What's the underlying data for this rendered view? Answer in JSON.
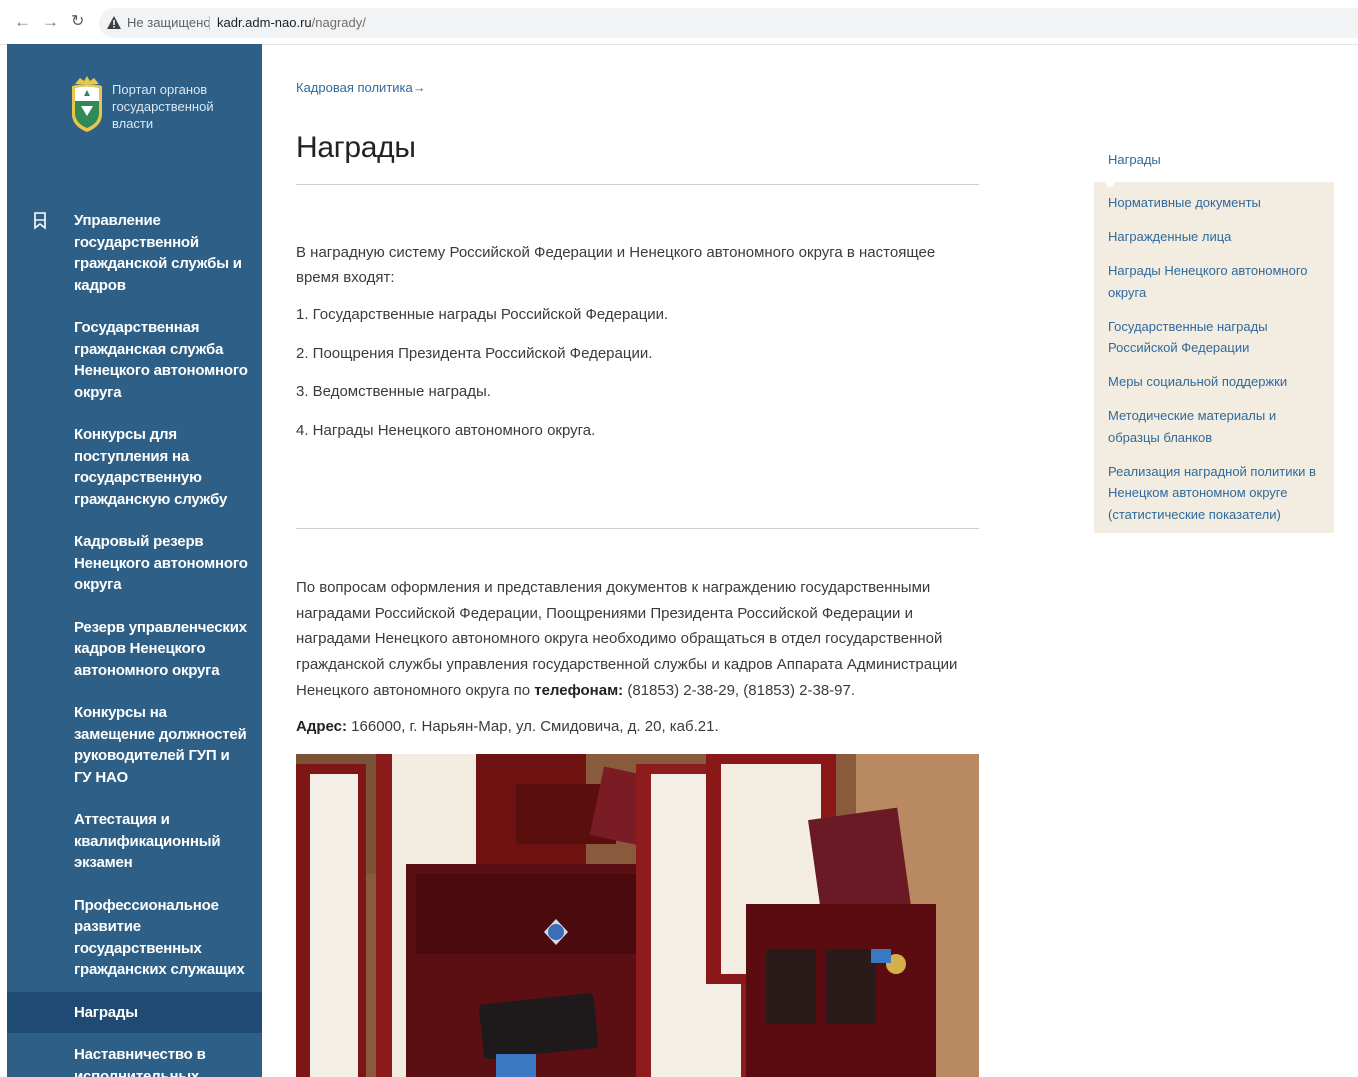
{
  "browser": {
    "security": "Не защищено",
    "url_host": "kadr.adm-nao.ru",
    "url_path": "/nagrady/"
  },
  "sidebar": {
    "portal_title": "Портал органов государственной власти",
    "items": [
      {
        "label": "Управление государственной гражданской службы и кадров",
        "icon": "bookmark-icon"
      },
      {
        "label": "Государственная гражданская служба Ненецкого автономного округа"
      },
      {
        "label": "Конкурсы для поступления на государственную гражданскую службу"
      },
      {
        "label": "Кадровый резерв Ненецкого автономного округа"
      },
      {
        "label": "Резерв управленческих кадров Ненецкого автономного округа"
      },
      {
        "label": "Конкурсы на замещение должностей руководителей ГУП и ГУ НАО"
      },
      {
        "label": "Аттестация и квалификационный экзамен"
      },
      {
        "label": "Профессиональное развитие государственных гражданских служащих"
      },
      {
        "label": "Награды",
        "active": true
      },
      {
        "label": "Наставничество в исполнительных"
      }
    ]
  },
  "main": {
    "breadcrumb": "Кадровая политика→",
    "title": "Награды",
    "intro": "В наградную систему Российской Федерации и Ненецкого автономного округа в настоящее время входят:",
    "list": [
      "1. Государственные награды Российской Федерации.",
      "2. Поощрения Президента Российской Федерации.",
      "3. Ведомственные награды.",
      "4. Награды Ненецкого автономного округа."
    ],
    "contact_text": "По вопросам оформления и представления документов к награждению государственными наградами Российской Федерации, Поощрениями Президента Российской Федерации и наградами Ненецкого автономного округа необходимо обращаться в отдел государственной гражданской службы управления государственной службы и кадров Аппарата Администрации Ненецкого автономного округа по",
    "phones_label": "телефонам:",
    "phones": "(81853) 2-38-29, (81853) 2-38-97.",
    "address_label": "Адрес:",
    "address": "166000, г. Нарьян-Мар, ул. Смидовича, д. 20, каб.21."
  },
  "right_menu": {
    "heading": "Награды",
    "items": [
      "Нормативные документы",
      "Награжденные лица",
      "Награды Ненецкого автономного округа",
      "Государственные награды Российской Федерации",
      "Меры социальной поддержки",
      "Методические материалы и образцы бланков",
      "Реализация наградной политики в Ненецком автономном округе (статистические показатели)"
    ]
  },
  "colors": {
    "sidebar_bg": "#2d5f87",
    "sidebar_active_bg": "#1f4a73",
    "link": "#2f6a9c",
    "right_menu_bg": "#f3ede1"
  }
}
